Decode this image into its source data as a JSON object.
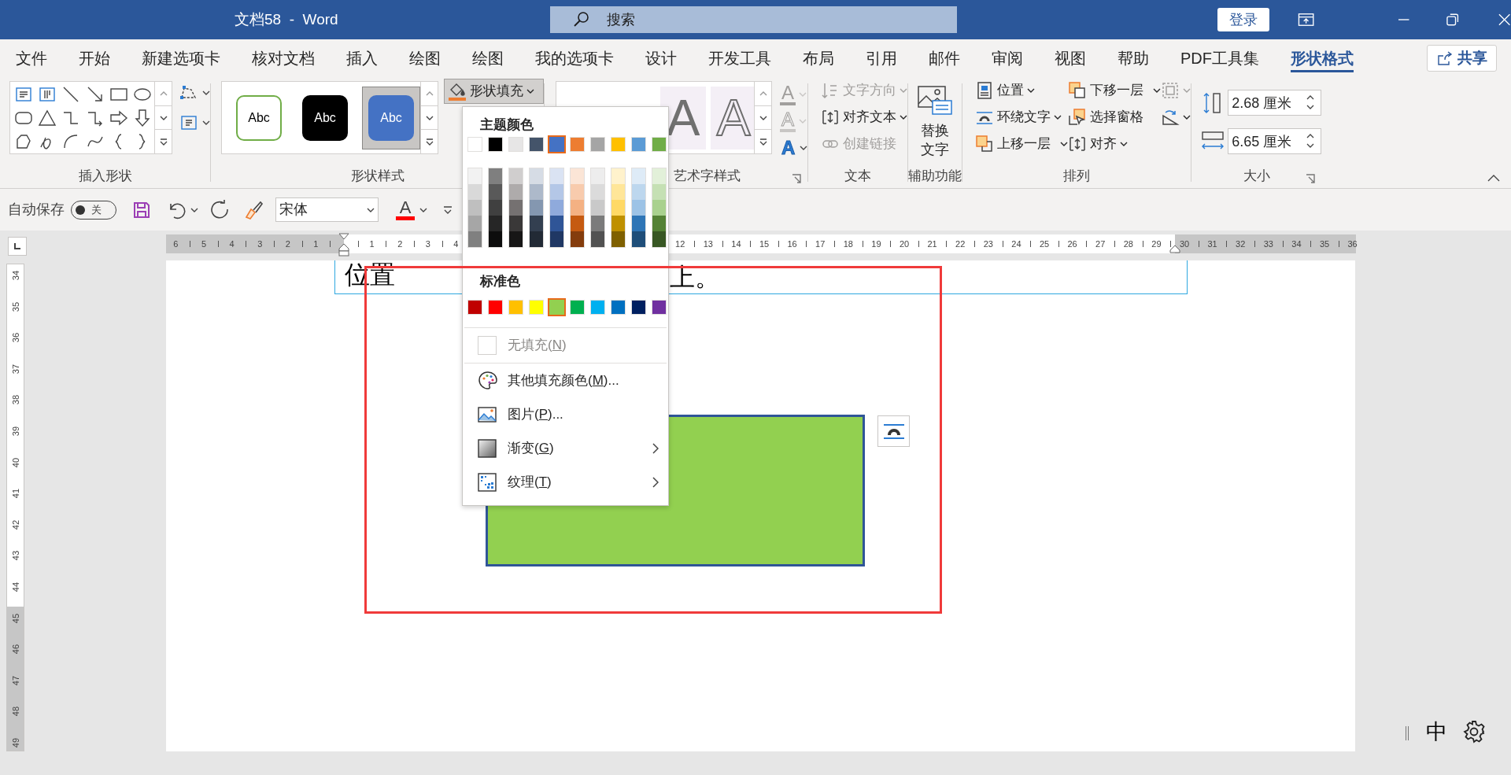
{
  "title_bar": {
    "title": "文档58  -  Word",
    "search_placeholder": "搜索",
    "sign_in": "登录"
  },
  "tabs": [
    {
      "label": "文件",
      "selected": false
    },
    {
      "label": "开始",
      "selected": false
    },
    {
      "label": "新建选项卡",
      "selected": false
    },
    {
      "label": "核对文档",
      "selected": false
    },
    {
      "label": "插入",
      "selected": false
    },
    {
      "label": "绘图",
      "selected": false
    },
    {
      "label": "绘图",
      "selected": false
    },
    {
      "label": "我的选项卡",
      "selected": false
    },
    {
      "label": "设计",
      "selected": false
    },
    {
      "label": "开发工具",
      "selected": false
    },
    {
      "label": "布局",
      "selected": false
    },
    {
      "label": "引用",
      "selected": false
    },
    {
      "label": "邮件",
      "selected": false
    },
    {
      "label": "审阅",
      "selected": false
    },
    {
      "label": "视图",
      "selected": false
    },
    {
      "label": "帮助",
      "selected": false
    },
    {
      "label": "PDF工具集",
      "selected": false
    },
    {
      "label": "形状格式",
      "selected": true
    }
  ],
  "share": "共享",
  "ribbon": {
    "insert_shapes": {
      "label": "插入形状"
    },
    "shape_styles": {
      "label": "形状样式",
      "styles": [
        {
          "label": "Abc",
          "kind": "outline",
          "color": "#70ad47",
          "selected": false
        },
        {
          "label": "Abc",
          "kind": "fill",
          "color": "#000000",
          "selected": false
        },
        {
          "label": "Abc",
          "kind": "fill",
          "color": "#4472c4",
          "selected": true
        }
      ],
      "fill_button": {
        "label": "形状填充",
        "expanded": true
      }
    },
    "wordart_styles": {
      "label": "艺术字样式",
      "previews": [
        {
          "glyph": "A",
          "kind": "fill"
        },
        {
          "glyph": "A",
          "kind": "outline"
        }
      ],
      "tools": [
        {
          "glyph": "A",
          "kind": "fill",
          "disabled": true
        },
        {
          "glyph": "A",
          "kind": "outline",
          "disabled": true
        },
        {
          "glyph": "A",
          "kind": "effects",
          "disabled": false
        }
      ]
    },
    "text": {
      "label": "文本",
      "items": [
        {
          "label": "文字方向",
          "kind": "direction",
          "disabled": true,
          "dropdown": true
        },
        {
          "label": "对齐文本",
          "kind": "align",
          "disabled": false,
          "dropdown": true
        },
        {
          "label": "创建链接",
          "kind": "link",
          "disabled": true,
          "dropdown": false
        }
      ]
    },
    "accessibility": {
      "label": "辅助功能",
      "button": "替换文字"
    },
    "arrange": {
      "label": "排列",
      "columns": [
        [
          {
            "label": "位置",
            "kind": "position",
            "disabled": false,
            "dropdown": true
          },
          {
            "label": "环绕文字",
            "kind": "wrap",
            "disabled": false,
            "dropdown": true
          },
          {
            "label": "上移一层",
            "kind": "forward",
            "disabled": false,
            "dropdown": true
          }
        ],
        [
          {
            "label": "下移一层",
            "kind": "backward",
            "disabled": false,
            "dropdown": true
          },
          {
            "label": "选择窗格",
            "kind": "selection",
            "disabled": false,
            "dropdown": false
          },
          {
            "label": "对齐",
            "kind": "align",
            "disabled": false,
            "dropdown": true
          }
        ],
        [
          {
            "kind": "group",
            "disabled": true,
            "dropdown": true
          },
          {
            "kind": "rotate",
            "disabled": false,
            "dropdown": true
          }
        ]
      ]
    },
    "size": {
      "label": "大小",
      "height": "2.68 厘米",
      "width": "6.65 厘米"
    }
  },
  "quick_access": {
    "autosave_label": "自动保存",
    "autosave_on": false,
    "autosave_state": "关",
    "font": "宋体",
    "font_color": {
      "glyph": "A",
      "color": "#ff0000"
    }
  },
  "ruler": {
    "left_margin_numbers": [
      "6",
      "5",
      "4",
      "3",
      "2",
      "1"
    ],
    "numbers": [
      "1",
      "2",
      "3",
      "4"
    ],
    "numbers_after_menu": [
      "12",
      "13",
      "14",
      "15",
      "16",
      "17",
      "18",
      "19",
      "20",
      "21",
      "22",
      "23",
      "24",
      "25",
      "26",
      "27",
      "28",
      "29"
    ],
    "right_margin_numbers": [
      "30",
      "31",
      "32",
      "33",
      "34",
      "35",
      "36"
    ]
  },
  "vertical_ruler": {
    "numbers": [
      "34",
      "35",
      "36",
      "37",
      "38",
      "39",
      "40",
      "41",
      "42",
      "43",
      "44",
      "45",
      "46",
      "47",
      "48",
      "49"
    ]
  },
  "document": {
    "text_fragments": [
      "位置",
      "上。"
    ]
  },
  "fill_menu": {
    "theme_colors_heading": "主题颜色",
    "theme_colors": [
      {
        "color": "#ffffff",
        "selected": false,
        "shades": [
          {
            "color": "#f2f2f2"
          },
          {
            "color": "#d9d9d9"
          },
          {
            "color": "#bfbfbf"
          },
          {
            "color": "#a6a6a6"
          },
          {
            "color": "#808080"
          }
        ]
      },
      {
        "color": "#000000",
        "selected": false,
        "shades": [
          {
            "color": "#7f7f7f"
          },
          {
            "color": "#595959"
          },
          {
            "color": "#404040"
          },
          {
            "color": "#262626"
          },
          {
            "color": "#0d0d0d"
          }
        ]
      },
      {
        "color": "#e7e6e6",
        "selected": false,
        "shades": [
          {
            "color": "#d0cece"
          },
          {
            "color": "#aeabab"
          },
          {
            "color": "#757171"
          },
          {
            "color": "#3a3838"
          },
          {
            "color": "#171616"
          }
        ]
      },
      {
        "color": "#44546a",
        "selected": false,
        "shades": [
          {
            "color": "#d6dce5"
          },
          {
            "color": "#adb9ca"
          },
          {
            "color": "#8497b0"
          },
          {
            "color": "#333f50"
          },
          {
            "color": "#222a35"
          }
        ]
      },
      {
        "color": "#4472c4",
        "selected": true,
        "shades": [
          {
            "color": "#dae3f3"
          },
          {
            "color": "#b4c7e7"
          },
          {
            "color": "#8faadc"
          },
          {
            "color": "#2f5597"
          },
          {
            "color": "#203864"
          }
        ]
      },
      {
        "color": "#ed7d31",
        "selected": false,
        "shades": [
          {
            "color": "#fbe5d6"
          },
          {
            "color": "#f8cbad"
          },
          {
            "color": "#f4b183"
          },
          {
            "color": "#c55a11"
          },
          {
            "color": "#843c0c"
          }
        ]
      },
      {
        "color": "#a5a5a5",
        "selected": false,
        "shades": [
          {
            "color": "#ededed"
          },
          {
            "color": "#dbdbdb"
          },
          {
            "color": "#c9c9c9"
          },
          {
            "color": "#7b7b7b"
          },
          {
            "color": "#525252"
          }
        ]
      },
      {
        "color": "#ffc000",
        "selected": false,
        "shades": [
          {
            "color": "#fff2cc"
          },
          {
            "color": "#ffe699"
          },
          {
            "color": "#ffd966"
          },
          {
            "color": "#bf9000"
          },
          {
            "color": "#7f6000"
          }
        ]
      },
      {
        "color": "#5b9bd5",
        "selected": false,
        "shades": [
          {
            "color": "#deebf7"
          },
          {
            "color": "#bdd7ee"
          },
          {
            "color": "#9dc3e6"
          },
          {
            "color": "#2e75b6"
          },
          {
            "color": "#1f4e79"
          }
        ]
      },
      {
        "color": "#70ad47",
        "selected": false,
        "shades": [
          {
            "color": "#e2f0d9"
          },
          {
            "color": "#c5e0b4"
          },
          {
            "color": "#a9d18e"
          },
          {
            "color": "#548235"
          },
          {
            "color": "#385723"
          }
        ]
      }
    ],
    "standard_colors_heading": "标准色",
    "standard_colors": [
      {
        "color": "#c00000",
        "selected": false
      },
      {
        "color": "#ff0000",
        "selected": false
      },
      {
        "color": "#ffc000",
        "selected": false
      },
      {
        "color": "#ffff00",
        "selected": false
      },
      {
        "color": "#92d050",
        "selected": true
      },
      {
        "color": "#00b050",
        "selected": false
      },
      {
        "color": "#00b0f0",
        "selected": false
      },
      {
        "color": "#0070c0",
        "selected": false
      },
      {
        "color": "#002060",
        "selected": false
      },
      {
        "color": "#7030a0",
        "selected": false
      }
    ],
    "items": [
      {
        "kind": "no-fill",
        "before": "无填充(",
        "key": "N",
        "after": ")",
        "disabled": true,
        "submenu": false
      },
      {
        "kind": "more-colors",
        "before": "其他填充颜色(",
        "key": "M",
        "after": ")...",
        "disabled": false,
        "submenu": false
      },
      {
        "kind": "picture",
        "before": "图片(",
        "key": "P",
        "after": ")...",
        "disabled": false,
        "submenu": false
      },
      {
        "kind": "gradient",
        "before": "渐变(",
        "key": "G",
        "after": ")",
        "disabled": false,
        "submenu": true
      },
      {
        "kind": "texture",
        "before": "纹理(",
        "key": "T",
        "after": ")",
        "disabled": false,
        "submenu": true
      }
    ]
  },
  "ime": {
    "mode": "中"
  }
}
